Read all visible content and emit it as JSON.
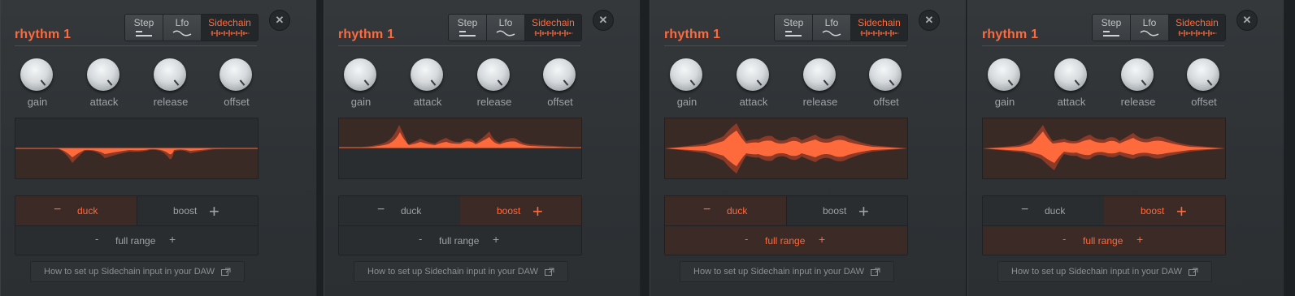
{
  "panels": [
    {
      "title": "rhythm 1",
      "tabs": [
        "Step",
        "Lfo",
        "Sidechain"
      ],
      "active_tab": "Sidechain",
      "knobs": [
        "gain",
        "attack",
        "release",
        "offset"
      ],
      "mode": {
        "duck": "duck",
        "boost": "boost",
        "full": "full range",
        "active": "duck",
        "full_active": false
      },
      "help": "How to set up Sidechain input in your DAW"
    },
    {
      "title": "rhythm 1",
      "tabs": [
        "Step",
        "Lfo",
        "Sidechain"
      ],
      "active_tab": "Sidechain",
      "knobs": [
        "gain",
        "attack",
        "release",
        "offset"
      ],
      "mode": {
        "duck": "duck",
        "boost": "boost",
        "full": "full range",
        "active": "boost",
        "full_active": false
      },
      "help": "How to set up Sidechain input in your DAW"
    },
    {
      "title": "rhythm 1",
      "tabs": [
        "Step",
        "Lfo",
        "Sidechain"
      ],
      "active_tab": "Sidechain",
      "knobs": [
        "gain",
        "attack",
        "release",
        "offset"
      ],
      "mode": {
        "duck": "duck",
        "boost": "boost",
        "full": "full range",
        "active": "duck",
        "full_active": true
      },
      "help": "How to set up Sidechain input in your DAW"
    },
    {
      "title": "rhythm 1",
      "tabs": [
        "Step",
        "Lfo",
        "Sidechain"
      ],
      "active_tab": "Sidechain",
      "knobs": [
        "gain",
        "attack",
        "release",
        "offset"
      ],
      "mode": {
        "duck": "duck",
        "boost": "boost",
        "full": "full range",
        "active": "boost",
        "full_active": true
      },
      "help": "How to set up Sidechain input in your DAW"
    }
  ],
  "icons": {
    "close": "close-icon",
    "step": "step-icon",
    "lfo": "lfo-wave-icon",
    "sidechain": "sidechain-waveform-icon",
    "external": "external-link-icon"
  },
  "colors": {
    "accent": "#ff6a3d",
    "panel": "#2e3235",
    "text": "#9ea2a5"
  }
}
